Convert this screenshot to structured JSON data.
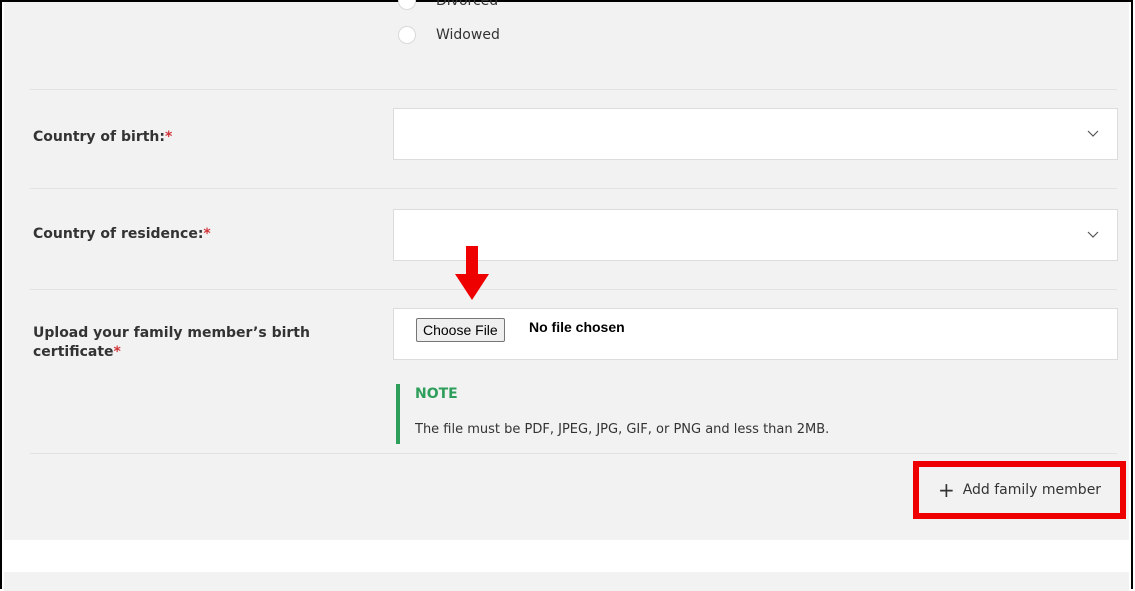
{
  "form": {
    "marital_status": {
      "options": [
        {
          "label": "Divorced"
        },
        {
          "label": "Widowed"
        }
      ]
    },
    "country_of_birth": {
      "label": "Country of birth:",
      "required_mark": "*",
      "value": ""
    },
    "country_of_residence": {
      "label": "Country of residence:",
      "required_mark": "*",
      "value": ""
    },
    "upload": {
      "label_line1": "Upload your family member’s birth",
      "label_line2": "certificate",
      "required_mark": "*",
      "button_label": "Choose File",
      "status": "No file chosen"
    },
    "note": {
      "title": "NOTE",
      "text": "The file must be PDF, JPEG, JPG, GIF, or PNG and less than 2MB."
    },
    "add_member": {
      "icon": "plus-icon",
      "label": "Add family member"
    }
  },
  "annotations": {
    "arrow_color": "#ee0000",
    "highlight_color": "#ee0000"
  },
  "colors": {
    "panel": "#f2f2f2",
    "note_accent": "#2e9e5b",
    "required": "#d13438"
  }
}
